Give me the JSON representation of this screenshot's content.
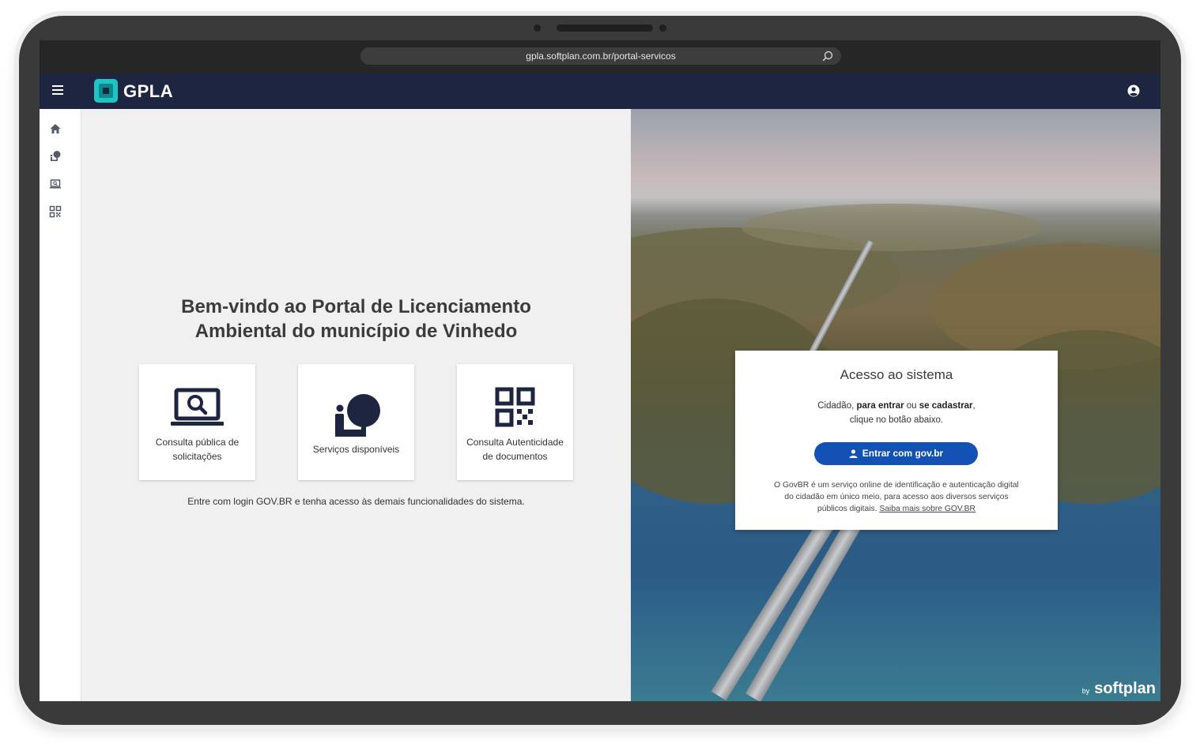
{
  "browser": {
    "url": "gpla.softplan.com.br/portal-servicos"
  },
  "appbar": {
    "logo_text": "GPLA"
  },
  "main": {
    "welcome_line1": "Bem-vindo ao Portal de Licenciamento",
    "welcome_line2": "Ambiental do município de Vinhedo",
    "cards": [
      {
        "label_line1": "Consulta pública de",
        "label_line2": "solicitações",
        "icon": "laptop-search-icon"
      },
      {
        "label_line1": "Serviços disponíveis",
        "label_line2": "",
        "icon": "person-tree-icon"
      },
      {
        "label_line1": "Consulta Autenticidade",
        "label_line2": "de documentos",
        "icon": "qr-code-icon"
      }
    ],
    "note": "Entre com login GOV.BR e tenha acesso às demais funcionalidades do sistema."
  },
  "login": {
    "title": "Acesso ao sistema",
    "body_prefix": "Cidadão, ",
    "body_bold1": "para entrar",
    "body_mid": " ou ",
    "body_bold2": "se cadastrar",
    "body_suffix": ",",
    "body_line2": "clique no botão abaixo.",
    "button_label": "Entrar com gov.br",
    "foot_line1": "O GovBR é um serviço online de identificação e autenticação digital",
    "foot_line2": "do cidadão em único meio, para acesso aos diversos serviços",
    "foot_line3": "públicos digitais.",
    "foot_link": "Saiba mais sobre GOV.BR"
  },
  "footer": {
    "by": "by",
    "brand": "softplan"
  },
  "colors": {
    "appbar": "#1e2540",
    "accent": "#20c4c4",
    "govbr_button": "#1351b4"
  }
}
